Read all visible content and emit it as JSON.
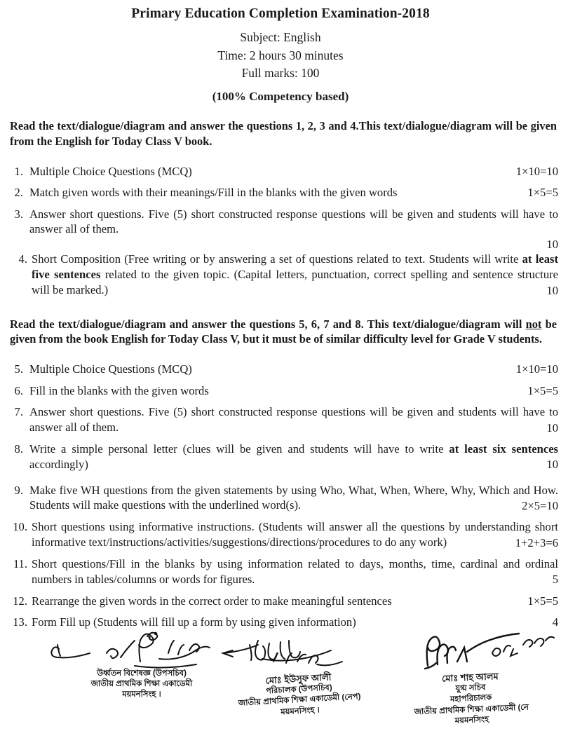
{
  "header": {
    "title": "Primary Education Completion Examination-2018",
    "subject": "Subject: English",
    "time": "Time: 2 hours 30 minutes",
    "full_marks": "Full marks: 100",
    "competency": "(100% Competency based)"
  },
  "instructions": {
    "first_a": "Read the text/dialogue/diagram and answer the questions 1, 2, 3 and 4.This text/dialogue/diagram will be given from the English for Today Class V book.",
    "second_pre": "Read the text/dialogue/diagram and answer the questions 5, 6, 7 and 8. This text/dialogue/diagram will ",
    "second_underlined": "not",
    "second_post": " be given from the book English for Today Class V, but it must be of similar difficulty level for Grade V students."
  },
  "questions": [
    {
      "num": "1.",
      "text": "Multiple Choice Questions (MCQ)",
      "marks": "1×10=10",
      "marks_position": "inline"
    },
    {
      "num": "2.",
      "text": "Match given words with their meanings/Fill in the blanks with the given words",
      "marks": "1×5=5",
      "marks_position": "inline"
    },
    {
      "num": "3.",
      "text": "Answer short questions. Five (5) short constructed response questions will be given and students will have to answer all of them.",
      "marks": "10",
      "marks_position": "below"
    },
    {
      "num": "4.",
      "text_part1": "Short Composition (Free writing or by answering a set of questions related to text. Students will write ",
      "text_bold": "at least five sentences",
      "text_part2": " related to the given topic. (Capital letters, punctuation, correct spelling and sentence structure will be marked.)",
      "marks": "10",
      "marks_position": "below"
    },
    {
      "num": "5.",
      "text": "Multiple Choice Questions (MCQ)",
      "marks": "1×10=10",
      "marks_position": "inline"
    },
    {
      "num": "6.",
      "text": "Fill in the blanks with the given words",
      "marks": "1×5=5",
      "marks_position": "inline"
    },
    {
      "num": "7.",
      "text": "Answer short questions. Five (5) short constructed response questions will be given and students will have to answer all of them.",
      "marks": "10",
      "marks_position": "below"
    },
    {
      "num": "8.",
      "text_part1": "Write a simple personal letter (clues will be given and students will have to write ",
      "text_bold": "at least six sentences",
      "text_part2": " accordingly)",
      "marks": "10",
      "marks_position": "below"
    },
    {
      "num": "9.",
      "text": "Make five WH questions from the given statements by using Who, What, When, Where, Why, Which and How. Students will make questions with the underlined word(s).",
      "marks": "2×5=10",
      "marks_position": "below"
    },
    {
      "num": "10.",
      "text": "Short questions using informative instructions. (Students will answer all the questions by understanding short informative text/instructions/activities/suggestions/directions/procedures to do any work)",
      "marks": "1+2+3=6",
      "marks_position": "below"
    },
    {
      "num": "11.",
      "text": "Short questions/Fill in the blanks by using information related to days, months, time, cardinal and ordinal numbers in tables/columns or words for figures.",
      "marks": "5",
      "marks_position": "below"
    },
    {
      "num": "12.",
      "text": "Rearrange the given words in the correct order to make meaningful sentences",
      "marks": "1×5=5",
      "marks_position": "inline"
    },
    {
      "num": "13.",
      "text": "Form Fill up (Students will fill up a form by using given information)",
      "marks": "4",
      "marks_position": "inline"
    }
  ],
  "signatures": [
    {
      "id": "left",
      "date": "২৬.০২.২০১৮",
      "designation": "উর্ধ্বতন বিশেষজ্ঞ (উপসচিব)",
      "org": "জাতীয় প্রাথমিক শিক্ষা একাডেমী",
      "place": "ময়মনসিংহ ।"
    },
    {
      "id": "middle",
      "date": "২৬/০২/১৮",
      "name": "মোঃ ইউসুফ আলী",
      "designation": "পরিচালক (উপসচিব)",
      "org": "জাতীয় প্রাথমিক শিক্ষা একাডেমী (নেপ)",
      "place": "ময়মনসিংহ ।"
    },
    {
      "id": "right",
      "date": "২৬/০২/২০১৮",
      "name": "মোঃ শাহ আলম",
      "rank": "যুগ্ম সচিব",
      "designation": "মহাপরিচালক",
      "org": "জাতীয় প্রাথমিক শিক্ষা একাডেমী (নে",
      "place": "ময়মনসিংহ"
    }
  ]
}
